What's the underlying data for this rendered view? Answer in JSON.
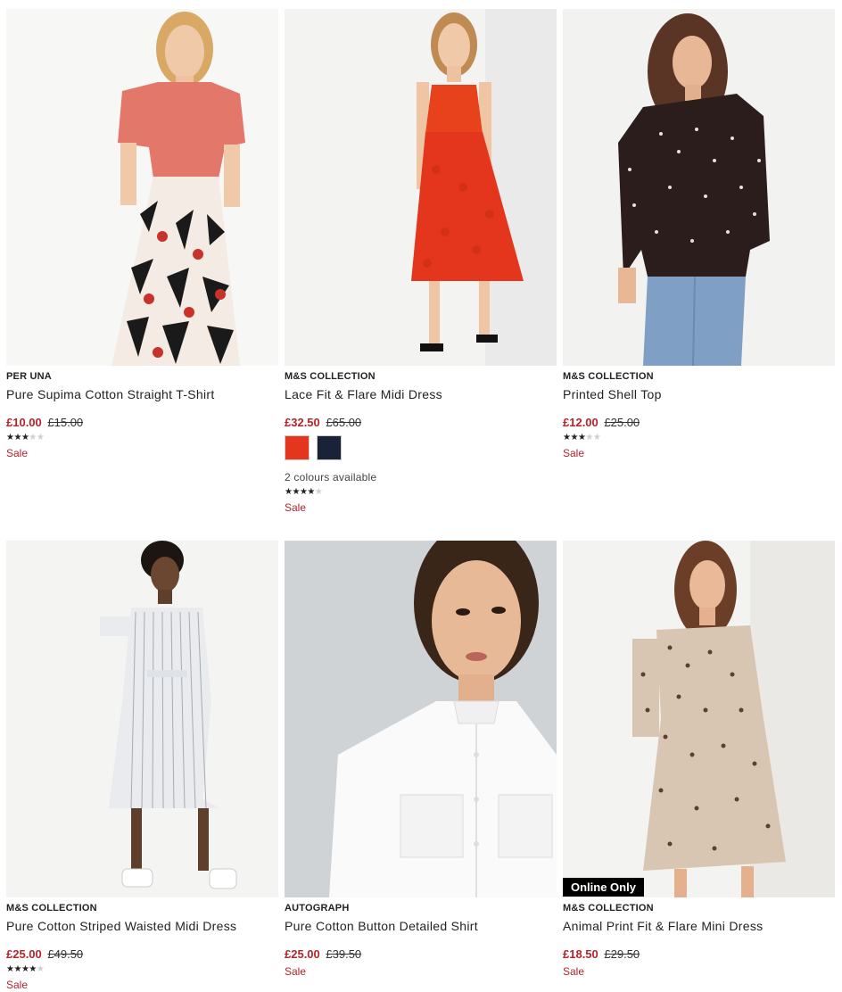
{
  "products": [
    {
      "brand": "PER UNA",
      "name": "Pure Supima Cotton Straight T-Shirt",
      "price_now": "£10.00",
      "price_was": "£15.00",
      "rating": 3,
      "sale_label": "Sale"
    },
    {
      "brand": "M&S COLLECTION",
      "name": "Lace Fit & Flare Midi Dress",
      "price_now": "£32.50",
      "price_was": "£65.00",
      "swatches": [
        {
          "color": "#e3361c"
        },
        {
          "color": "#1a2238"
        }
      ],
      "colours_text": "2 colours available",
      "rating": 4,
      "sale_label": "Sale"
    },
    {
      "brand": "M&S COLLECTION",
      "name": "Printed Shell Top",
      "price_now": "£12.00",
      "price_was": "£25.00",
      "rating": 3.5,
      "sale_label": "Sale"
    },
    {
      "brand": "M&S COLLECTION",
      "name": "Pure Cotton Striped Waisted Midi Dress",
      "price_now": "£25.00",
      "price_was": "£49.50",
      "rating": 4,
      "sale_label": "Sale"
    },
    {
      "brand": "AUTOGRAPH",
      "name": "Pure Cotton Button Detailed Shirt",
      "price_now": "£25.00",
      "price_was": "£39.50",
      "sale_label": "Sale"
    },
    {
      "brand": "M&S COLLECTION",
      "name": "Animal Print Fit & Flare Mini Dress",
      "price_now": "£18.50",
      "price_was": "£29.50",
      "sale_label": "Sale",
      "badge": "Online Only"
    }
  ],
  "colors": {
    "sale_red": "#b3252b",
    "badge_bg": "#000000"
  }
}
